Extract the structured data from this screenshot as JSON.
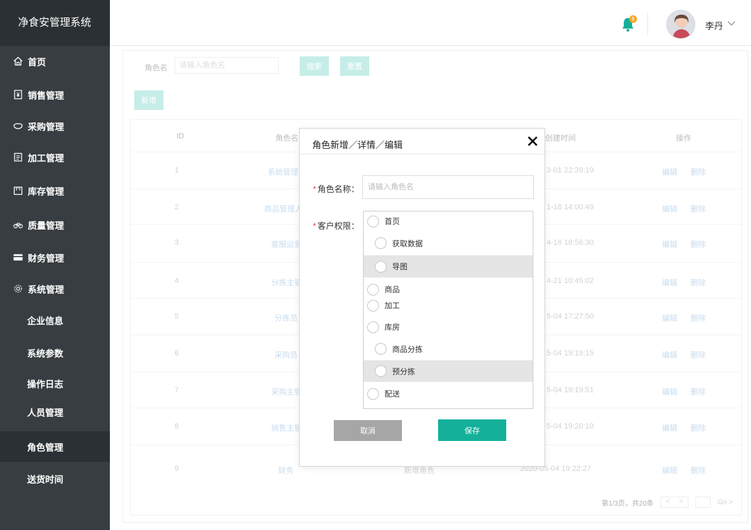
{
  "app": {
    "title": "净食安管理系统"
  },
  "sidebar": {
    "items": [
      {
        "label": "首页",
        "icon": "home-icon"
      },
      {
        "label": "销售管理",
        "icon": "yen-doc-icon"
      },
      {
        "label": "采购管理",
        "icon": "hand-icon"
      },
      {
        "label": "加工管理",
        "icon": "clipboard-icon"
      },
      {
        "label": "库存管理",
        "icon": "warehouse-icon"
      },
      {
        "label": "质量管理",
        "icon": "bicycle-icon"
      },
      {
        "label": "财务管理",
        "icon": "card-icon"
      },
      {
        "label": "系统管理",
        "icon": "gear-icon"
      }
    ],
    "sub_items": [
      {
        "label": "企业信息"
      },
      {
        "label": "系统参数"
      },
      {
        "label": "操作日志"
      },
      {
        "label": "人员管理"
      },
      {
        "label": "角色管理"
      },
      {
        "label": "送货时间"
      }
    ],
    "active_sub": "角色管理"
  },
  "header": {
    "notification_count": "6",
    "username": "李丹"
  },
  "search": {
    "label": "角色名",
    "placeholder": "请输入角色名",
    "search_button": "搜索",
    "reset_button": "重置",
    "add_button": "新增"
  },
  "table": {
    "columns": [
      "ID",
      "角色名",
      "创建时间",
      "操作"
    ],
    "rows": [
      {
        "id": "1",
        "name": "系统管理员",
        "created": "3-01 22:39:19"
      },
      {
        "id": "2",
        "name": "商品管理人",
        "created": "1-18 14:00:49"
      },
      {
        "id": "3",
        "name": "客服运营",
        "created": "4-16 18:56:30"
      },
      {
        "id": "4",
        "name": "分拣主管",
        "created": "4-21 10:45:02"
      },
      {
        "id": "5",
        "name": "分拣员",
        "created": "5-04 17:27:50"
      },
      {
        "id": "6",
        "name": "采购员",
        "created": "5-04 19:19:15"
      },
      {
        "id": "7",
        "name": "采购主管",
        "created": "5-04 19:19:51"
      },
      {
        "id": "8",
        "name": "销售主管",
        "created": "5-04 19:20:10"
      },
      {
        "id": "9",
        "name": "财务",
        "desc": "新增角色",
        "created": "2020-05-04 19:22:27"
      }
    ],
    "edit_label": "编辑",
    "delete_label": "删除"
  },
  "pagination": {
    "summary": "第1/3页，共20条",
    "prev": "<",
    "next": ">",
    "go": "Go >"
  },
  "modal": {
    "title": "角色新增／详情／编辑",
    "name_label": "角色名称：",
    "name_placeholder": "请输入角色名",
    "perm_label": "客户权限：",
    "required_mark": "*",
    "permissions": [
      {
        "label": "首页",
        "level": 0
      },
      {
        "label": "获取数据",
        "level": 1
      },
      {
        "label": "导图",
        "level": 1,
        "highlighted": true
      },
      {
        "label": "商品",
        "level": 0
      },
      {
        "label": "加工",
        "level": 0
      },
      {
        "label": "库房",
        "level": 0
      },
      {
        "label": "商品分拣",
        "level": 1
      },
      {
        "label": "预分拣",
        "level": 1,
        "highlighted": true
      },
      {
        "label": "配送",
        "level": 0
      }
    ],
    "cancel": "取消",
    "save": "保存"
  },
  "colors": {
    "sidebar_bg": "#373d41",
    "sidebar_active": "#2b3034",
    "accent": "#14b09a",
    "accent_soft": "#a8e4dc",
    "link": "#a9cbe9",
    "badge": "#f5a623"
  }
}
